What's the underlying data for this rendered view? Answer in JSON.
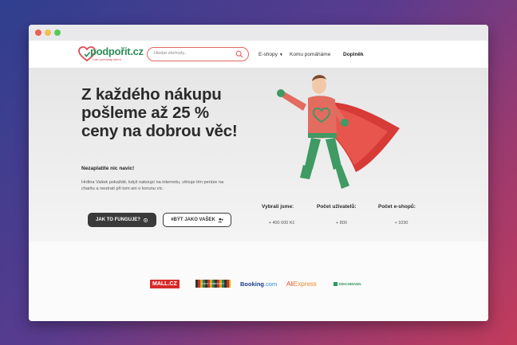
{
  "browser": {
    "controls": [
      "close",
      "minimize",
      "maximize"
    ]
  },
  "header": {
    "logo_text": "podpořit",
    "logo_tld": ".cz",
    "logo_tagline": "Lidé pomáhají lidem",
    "search_placeholder": "Hledat obchody..",
    "nav": {
      "eshopy": "E-shopy",
      "komu": "Komu pomáháme",
      "doplnek": "Doplněk"
    }
  },
  "hero": {
    "headline": "Z každého nákupu pošleme až 25 % ceny na dobrou věc!",
    "subhead": "Nezaplatíte nic navíc!",
    "description": "Hrdina Vašek pokaždé, když nakoupí na internetu, věnuje tím peníze na charitu a neutratí při tom ani o korunu víc.",
    "btn_primary": "JAK TO FUNGUJE?",
    "btn_secondary": "#BÝT JAKO VAŠEK"
  },
  "stats": [
    {
      "label": "Vybrali jsme:",
      "value": "+ 400 000 Kč"
    },
    {
      "label": "Počet uživatelů:",
      "value": "+ 800"
    },
    {
      "label": "Počet e-shopů:",
      "value": "+ 1030"
    }
  ],
  "partners": {
    "mall": "MALL.CZ",
    "knihy": "KNIHY DOBROVSKÝ",
    "booking_main": "Booking",
    "booking_suffix": ".com",
    "ali_a": "Ali",
    "ali_b": "Express",
    "deichmann": "DEICHMANN"
  },
  "colors": {
    "brand_green": "#2f8f5a",
    "brand_red": "#d94b55",
    "dark": "#3a3a3a"
  }
}
